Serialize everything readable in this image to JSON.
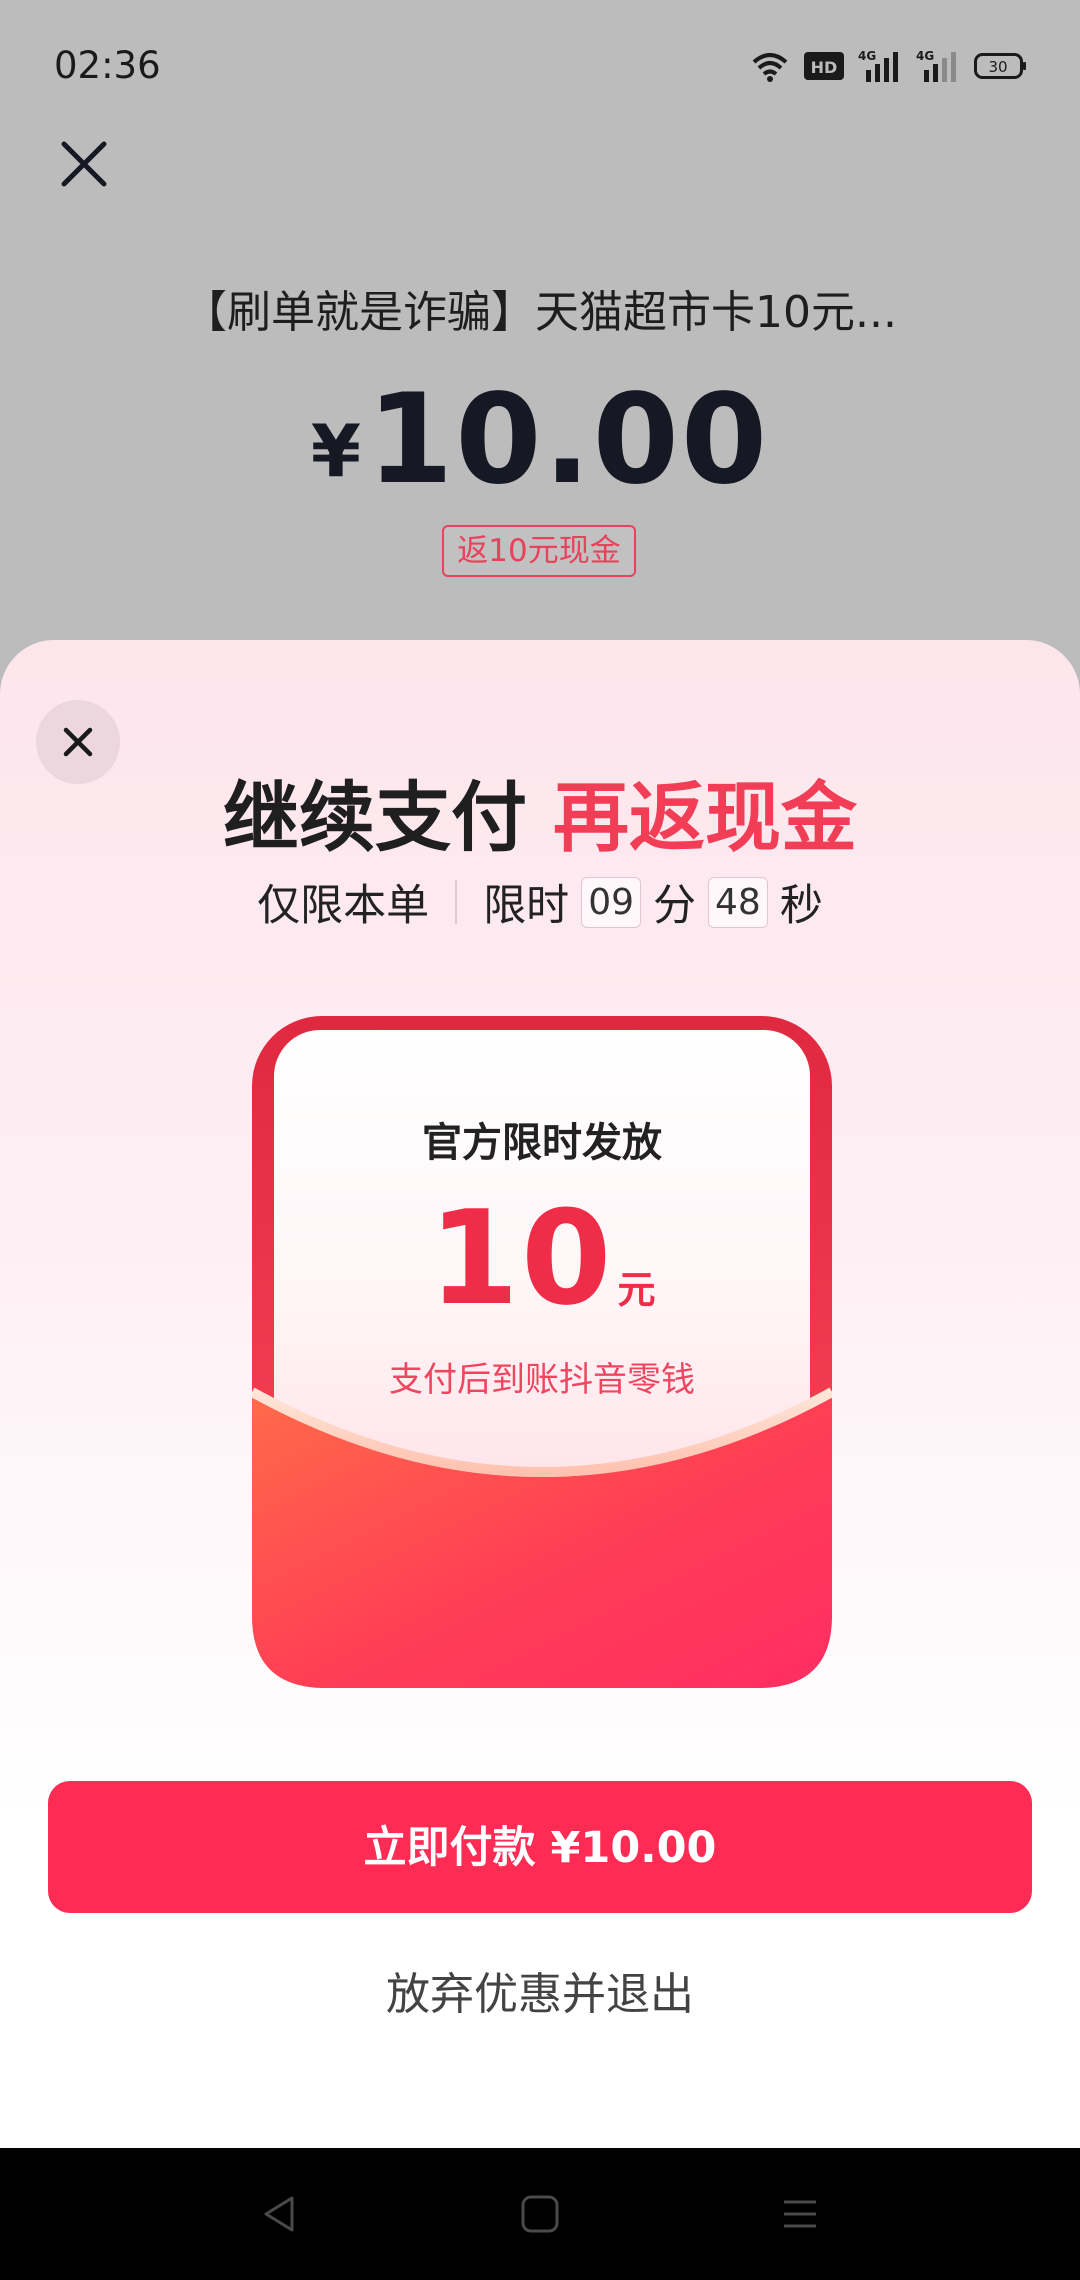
{
  "status_bar": {
    "time": "02:36",
    "hd_label": "HD",
    "network_1": "4G",
    "network_2": "4G",
    "battery": "30"
  },
  "product": {
    "title": "【刷单就是诈骗】天猫超市卡10元...",
    "currency_symbol": "¥",
    "price": "10.00",
    "cashback_tag": "返10元现金"
  },
  "sheet": {
    "headline_dark": "继续支付",
    "headline_red": "再返现金",
    "limit_text": "仅限本单",
    "timer_label": "限时",
    "minutes": "09",
    "minutes_unit": "分",
    "seconds": "48",
    "seconds_unit": "秒",
    "card": {
      "title": "官方限时发放",
      "amount": "10",
      "unit": "元",
      "note": "支付后到账抖音零钱"
    },
    "pay_button": "立即付款 ¥10.00",
    "abandon_link": "放弃优惠并退出"
  },
  "colors": {
    "accent": "#fe2c55",
    "headline_red": "#f23d56",
    "overlay": "#bcbcbc"
  },
  "icons": [
    "wifi-icon",
    "hd-icon",
    "signal-icon",
    "battery-icon",
    "close-icon",
    "back-icon",
    "home-icon",
    "menu-icon"
  ]
}
